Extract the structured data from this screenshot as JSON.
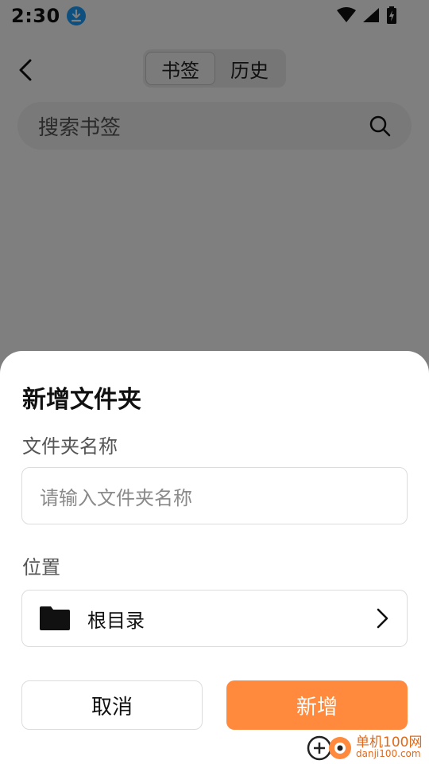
{
  "status_bar": {
    "time": "2:30"
  },
  "nav": {
    "tabs": [
      {
        "label": "书签",
        "active": true
      },
      {
        "label": "历史",
        "active": false
      }
    ]
  },
  "search": {
    "placeholder": "搜索书签"
  },
  "dialog": {
    "title": "新增文件夹",
    "name_label": "文件夹名称",
    "name_placeholder": "请输入文件夹名称",
    "location_label": "位置",
    "location_value": "根目录",
    "cancel_label": "取消",
    "confirm_label": "新增"
  },
  "watermark": {
    "line1": "单机100网",
    "line2": "danji100.com"
  },
  "colors": {
    "accent": "#ff8a3d",
    "download_badge": "#1aa0ff",
    "overlay": "rgba(0,0,0,0.5)"
  }
}
